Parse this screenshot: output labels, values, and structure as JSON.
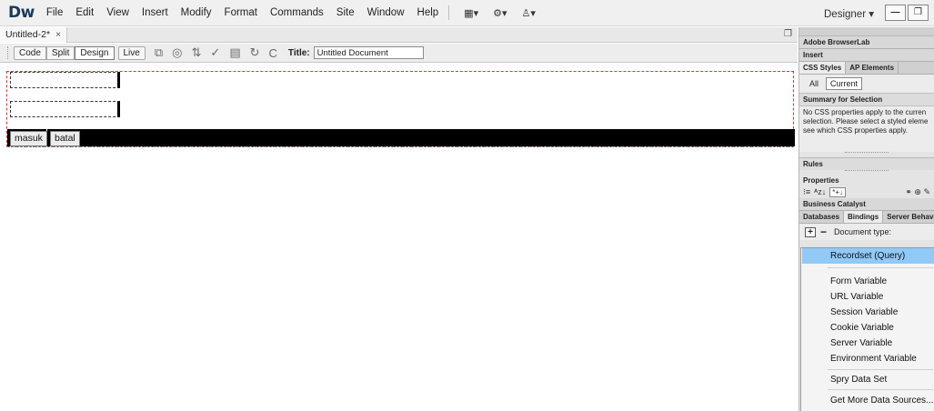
{
  "app": {
    "logo": "Dw",
    "menu": [
      "File",
      "Edit",
      "View",
      "Insert",
      "Modify",
      "Format",
      "Commands",
      "Site",
      "Window",
      "Help"
    ],
    "menu_icons": [
      "layout-icon",
      "gear-icon",
      "sitefiles-icon"
    ],
    "workspace": "Designer ▾",
    "window_buttons": [
      "minimize-icon",
      "restore-icon"
    ]
  },
  "document": {
    "tab_label": "Untitled-2*",
    "tab_close": "×",
    "view_buttons": [
      "Code",
      "Split",
      "Design",
      "Live"
    ],
    "active_view": "Design",
    "title_label": "Title:",
    "title_value": "Untitled Document"
  },
  "form": {
    "buttons": [
      "masuk",
      "batal"
    ]
  },
  "panel": {
    "browserlab": "Adobe BrowserLab",
    "insert": "Insert",
    "css_tabs": [
      "CSS Styles",
      "AP Elements"
    ],
    "mode_buttons": [
      "All",
      "Current"
    ],
    "summary_title": "Summary for Selection",
    "summary_lines": [
      "No CSS properties apply to the curren",
      "selection.  Please select a styled eleme",
      "see which CSS properties apply."
    ],
    "rules": "Rules",
    "properties": "Properties",
    "business_catalyst": "Business Catalyst",
    "bind_tabs": [
      "Databases",
      "Bindings",
      "Server Behavior"
    ],
    "active_bind_tab": "Bindings",
    "doc_type_label": "Document type:"
  },
  "dropdown": {
    "items": [
      "Recordset (Query)",
      "Form Variable",
      "URL Variable",
      "Session Variable",
      "Cookie Variable",
      "Server Variable",
      "Environment Variable",
      "Spry Data Set",
      "Get More Data Sources..."
    ],
    "highlighted": "Recordset (Query)"
  }
}
